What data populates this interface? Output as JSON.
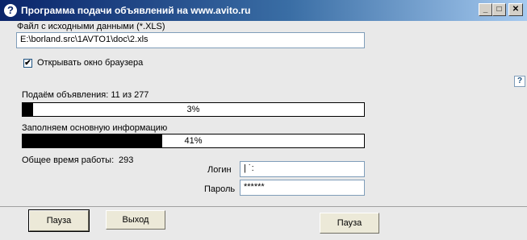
{
  "window": {
    "title": "Программа подачи объявлений на www.avito.ru",
    "help_glyph": "?",
    "minimize_icon": "minimize-icon",
    "maximize_icon": "maximize-icon",
    "close_icon": "close-icon"
  },
  "file": {
    "label": "Файл с исходными данными (*.XLS)",
    "value": "E:\\borland.src\\1AVTO1\\doc\\2.xls"
  },
  "browser": {
    "label": "Открывать окно браузера",
    "checked": true,
    "check_glyph": "✔"
  },
  "progress_ads": {
    "label": "Подаём объявления: 11 из 277",
    "percent": 3,
    "text": "3%"
  },
  "progress_info": {
    "label": "Заполняем основную информацию",
    "percent": 41,
    "text": "41%"
  },
  "work_time": {
    "label": "Общее время работы:",
    "value": "293"
  },
  "login": {
    "label": "Логин",
    "value": "|        ˙:"
  },
  "password": {
    "label": "Пароль",
    "value": "******"
  },
  "buttons": {
    "pause_left": "Пауза",
    "exit": "Выход",
    "pause_right": "Пауза"
  }
}
